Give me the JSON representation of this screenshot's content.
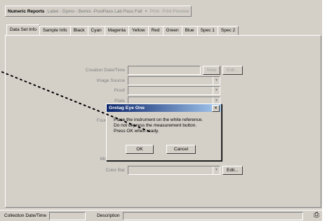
{
  "toolbar": {
    "reports_label": "Numeric Reports",
    "reports_value": "Label - Dymo - Bemis -PoolPass Lab Pass Fail",
    "print_label": "Print",
    "print_preview_label": "Print Preview"
  },
  "tabs": [
    {
      "label": "Data Set Info"
    },
    {
      "label": "Sample Info"
    },
    {
      "label": "Black"
    },
    {
      "label": "Cyan"
    },
    {
      "label": "Magenta"
    },
    {
      "label": "Yellow"
    },
    {
      "label": "Red"
    },
    {
      "label": "Green"
    },
    {
      "label": "Blue"
    },
    {
      "label": "Spec 1"
    },
    {
      "label": "Spec 2"
    }
  ],
  "form": {
    "creation_label": "Creation Date/Time",
    "now_button": "Now",
    "edit_button": "Edit...",
    "image_source_label": "Image Source",
    "proof_label": "Proof",
    "plate_label": "Plate",
    "fountain_label": "Fountain Solu",
    "misc_label": "Misc. Inform",
    "colorbar_label": "Color Bar",
    "colorbar_edit": "Edit..."
  },
  "dialog": {
    "title": "Gretag Eye One",
    "line1": "Place the instrument on the white reference.",
    "line2": "Do not depress the measurement button.",
    "line3": "Press OK when ready.",
    "ok": "OK",
    "cancel": "Cancel"
  },
  "status": {
    "collection_label": "Collection Date/Time",
    "description_label": "Description"
  },
  "icons": [
    "dropdown-arrow-icon",
    "close-icon",
    "printer-icon"
  ]
}
